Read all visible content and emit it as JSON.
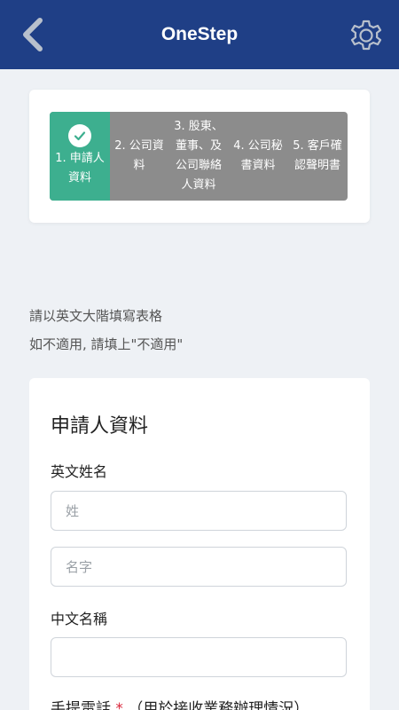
{
  "app": {
    "title": "OneStep"
  },
  "header": {
    "back_icon": "chevron-left-icon",
    "settings_icon": "gear-icon"
  },
  "stepper": {
    "steps": [
      {
        "label": "1. 申請人\n資料",
        "active": true,
        "completed": true
      },
      {
        "label": "2. 公司資\n料",
        "active": false
      },
      {
        "label": "3. 股東、\n董事、及\n公司聯絡\n人資料",
        "active": false
      },
      {
        "label": "4. 公司秘\n書資料",
        "active": false
      },
      {
        "label": "5. 客戶確\n認聲明書",
        "active": false
      }
    ],
    "active_color": "#3daf8f",
    "inactive_color": "#8c8c8c"
  },
  "notes": {
    "line1": "請以英文大階填寫表格",
    "line2": "如不適用, 請填上\"不適用\""
  },
  "form": {
    "section_title": "申請人資料",
    "english_name_label": "英文姓名",
    "surname_placeholder": "姓",
    "given_name_placeholder": "名字",
    "chinese_name_label": "中文名稱",
    "chinese_name_value": "",
    "mobile_label": "手提電話",
    "mobile_required_mark": "*",
    "mobile_label_note": "（用於接收業務辦理情況）"
  },
  "colors": {
    "header_bg": "#1f3f86",
    "page_bg": "#eef1f5",
    "required": "#d9263a"
  }
}
